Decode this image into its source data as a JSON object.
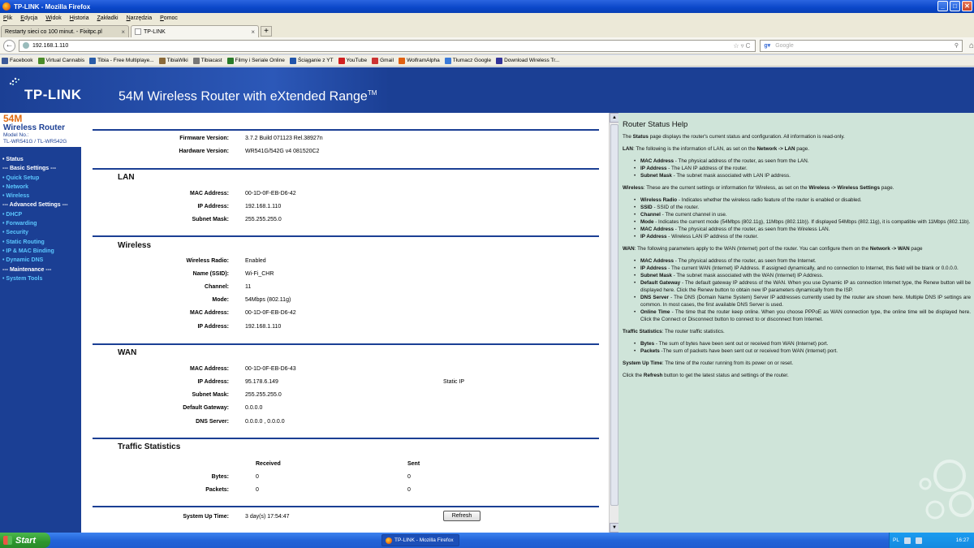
{
  "window": {
    "title": "TP-LINK - Mozilla Firefox"
  },
  "menubar": [
    "Plik",
    "Edycja",
    "Widok",
    "Historia",
    "Zakładki",
    "Narzędzia",
    "Pomoc"
  ],
  "tabs": [
    {
      "label": "Restarty sieci co 100 minut. - Fixitpc.pl"
    },
    {
      "label": "TP-LINK"
    }
  ],
  "navbar": {
    "url": "192.168.1.110",
    "search_placeholder": "Google"
  },
  "bookmarks": [
    {
      "label": "Facebook",
      "color": "#3b5998"
    },
    {
      "label": "Virtual Cannabis",
      "color": "#4a8a2a"
    },
    {
      "label": "Tibia - Free Multiplaye...",
      "color": "#2a5ca8"
    },
    {
      "label": "TibiaWiki",
      "color": "#8a6a3a"
    },
    {
      "label": "Tibiacast",
      "color": "#777777"
    },
    {
      "label": "Filmy i Seriale Online",
      "color": "#2a7a2a"
    },
    {
      "label": "Ściąganie z YT",
      "color": "#2255aa"
    },
    {
      "label": "YouTube",
      "color": "#d02020"
    },
    {
      "label": "Gmail",
      "color": "#c33"
    },
    {
      "label": "WolframAlpha",
      "color": "#e06010"
    },
    {
      "label": "Tłumacz Google",
      "color": "#3a7ad8"
    },
    {
      "label": "Download Wireless Tr...",
      "color": "#333399"
    }
  ],
  "banner": {
    "logo": "TP-LINK",
    "product": "54M Wireless Router with eXtended Range",
    "trademark": "TM"
  },
  "leftnav": {
    "model_speed": "54M",
    "model_type": "Wireless  Router",
    "model_no_label": "Model No.:",
    "model_numbers": "TL-WR541G / TL-WR542G",
    "items": [
      {
        "label": "• Status",
        "kind": "white"
      },
      {
        "label": "--- Basic Settings ---",
        "kind": "section"
      },
      {
        "label": "• Quick Setup",
        "kind": "link"
      },
      {
        "label": "• Network",
        "kind": "link"
      },
      {
        "label": "• Wireless",
        "kind": "link"
      },
      {
        "label": "--- Advanced Settings ---",
        "kind": "section"
      },
      {
        "label": "• DHCP",
        "kind": "link"
      },
      {
        "label": "• Forwarding",
        "kind": "link"
      },
      {
        "label": "• Security",
        "kind": "link"
      },
      {
        "label": "• Static Routing",
        "kind": "link"
      },
      {
        "label": "• IP & MAC Binding",
        "kind": "link"
      },
      {
        "label": "• Dynamic DNS",
        "kind": "link"
      },
      {
        "label": "--- Maintenance ---",
        "kind": "section"
      },
      {
        "label": "• System Tools",
        "kind": "link"
      }
    ]
  },
  "status": {
    "firmware_label": "Firmware Version:",
    "firmware_value": "3.7.2 Build 071123 Rel.38927n",
    "hardware_label": "Hardware Version:",
    "hardware_value": "WR541G/542G v4 081520C2",
    "lan": {
      "title": "LAN",
      "mac_label": "MAC Address:",
      "mac_value": "00-1D-0F-EB-D6-42",
      "ip_label": "IP Address:",
      "ip_value": "192.168.1.110",
      "mask_label": "Subnet Mask:",
      "mask_value": "255.255.255.0"
    },
    "wireless": {
      "title": "Wireless",
      "radio_label": "Wireless Radio:",
      "radio_value": "Enabled",
      "ssid_label": "Name (SSID):",
      "ssid_value": "Wi-Fi_CHR",
      "channel_label": "Channel:",
      "channel_value": "11",
      "mode_label": "Mode:",
      "mode_value": "54Mbps (802.11g)",
      "mac_label": "MAC Address:",
      "mac_value": "00-1D-0F-EB-D6-42",
      "ip_label": "IP Address:",
      "ip_value": "192.168.1.110"
    },
    "wan": {
      "title": "WAN",
      "mac_label": "MAC Address:",
      "mac_value": "00-1D-0F-EB-D6-43",
      "ip_label": "IP Address:",
      "ip_value": "95.178.6.149",
      "ip_type": "Static IP",
      "mask_label": "Subnet Mask:",
      "mask_value": "255.255.255.0",
      "gw_label": "Default Gateway:",
      "gw_value": "0.0.0.0",
      "dns_label": "DNS Server:",
      "dns_value": "0.0.0.0 , 0.0.0.0"
    },
    "traffic": {
      "title": "Traffic Statistics",
      "received_header": "Received",
      "sent_header": "Sent",
      "bytes_label": "Bytes:",
      "bytes_received": "0",
      "bytes_sent": "0",
      "packets_label": "Packets:",
      "packets_received": "0",
      "packets_sent": "0"
    },
    "uptime_label": "System Up Time:",
    "uptime_value": "3 day(s) 17:54:47",
    "refresh_label": "Refresh"
  },
  "help": {
    "title": "Router Status Help",
    "intro_pre": "The ",
    "intro_bold": "Status",
    "intro_post": " page displays the router's current status and configuration. All information is read-only.",
    "lan_head_bold": "LAN",
    "lan_head_text": ": The following is the information of LAN, as set on the ",
    "lan_head_link": "Network -> LAN",
    "lan_head_end": " page.",
    "lan_items": [
      {
        "b": "MAC Address",
        "t": " - The physical address of the router, as seen from the LAN."
      },
      {
        "b": "IP Address",
        "t": " - The LAN IP address of the router."
      },
      {
        "b": "Subnet Mask",
        "t": " - The subnet mask associated with LAN IP address."
      }
    ],
    "wl_head_bold": "Wireless",
    "wl_head_text": ": These are the current settings or information for Wireless, as set on the ",
    "wl_head_link": "Wireless -> Wireless Settings",
    "wl_head_end": " page.",
    "wl_items": [
      {
        "b": "Wireless Radio",
        "t": " - Indicates whether the wireless radio feature of the router is enabled or disabled."
      },
      {
        "b": "SSID",
        "t": " - SSID of the router."
      },
      {
        "b": "Channel",
        "t": " - The current channel in use."
      },
      {
        "b": "Mode",
        "t": " - Indicates the current mode (54Mbps (802.11g), 11Mbps (802.11b)). If displayed 54Mbps (802.11g), it is compatible with 11Mbps (802.11b)."
      },
      {
        "b": "MAC Address",
        "t": " - The physical address of the router, as seen from the Wireless LAN."
      },
      {
        "b": "IP Address",
        "t": " - Wireless LAN IP address of the router."
      }
    ],
    "wan_head_bold": "WAN",
    "wan_head_text": ": The following parameters apply to the WAN (Internet) port of the router. You can configure them on the ",
    "wan_head_link": "Network -> WAN",
    "wan_head_end": " page",
    "wan_items": [
      {
        "b": "MAC Address",
        "t": " - The physical address of the router, as seen from the Internet."
      },
      {
        "b": "IP Address",
        "t": " - The current WAN (Internet) IP Address. If assigned dynamically, and no connection to Internet, this field will be blank or 0.0.0.0."
      },
      {
        "b": "Subnet Mask",
        "t": " - The subnet mask associated with the WAN (Internet) IP Address."
      },
      {
        "b": "Default Gateway",
        "t": " - The default gateway IP address of the WAN. When you use Dynamic IP as connection Internet type, the Renew button will be displayed here. Click the Renew button to obtain new IP parameters dynamically from the ISP."
      },
      {
        "b": "DNS Server",
        "t": " - The DNS (Domain Name System) Server IP addresses currently used by the router are shown here. Multiple DNS IP settings are common. In most cases, the first available DNS Server is used."
      },
      {
        "b": "Online Time",
        "t": " - The time that the router keep online. When you choose PPPoE as WAN connection type, the online time will be displayed here. Click the Connect or Disconnect button to connect to or disconnect from Internet."
      }
    ],
    "traffic_head_bold": "Traffic Statistics",
    "traffic_head_text": ": The router traffic statistics.",
    "traffic_items": [
      {
        "b": "Bytes",
        "t": " - The sum of bytes have been sent out or received from WAN (Internet) port."
      },
      {
        "b": "Packets",
        "t": " -The sum of packets have been sent out or received from WAN (Internet) port."
      }
    ],
    "uptime_bold": "System Up Time",
    "uptime_text": ": The time of the router running from its power on or reset.",
    "refresh_pre": "Click the ",
    "refresh_bold": "Refresh",
    "refresh_post": " button to get the latest status and settings of the router."
  },
  "taskbar": {
    "start": "Start",
    "task_item": "TP-LINK - Mozilla Firefox",
    "lang": "PL",
    "time": "16:27"
  }
}
